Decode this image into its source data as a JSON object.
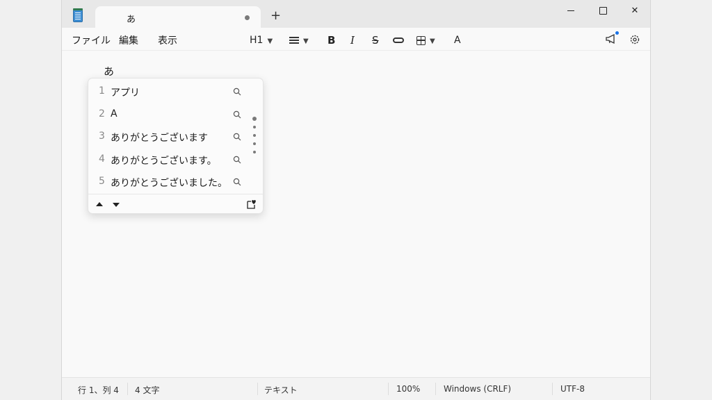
{
  "window": {
    "tab_title": "あ",
    "new_tab": "+",
    "close_glyph": "✕"
  },
  "menu": {
    "file": "ファイル",
    "edit": "編集",
    "view": "表示"
  },
  "toolbar": {
    "heading": "H1",
    "bold": "B",
    "italic": "I",
    "strikethrough": "S",
    "spellcheck": "A"
  },
  "editor": {
    "text": "あ"
  },
  "ime": {
    "candidates": [
      {
        "num": "1",
        "text": "アプリ"
      },
      {
        "num": "2",
        "text": "A"
      },
      {
        "num": "3",
        "text": "ありがとうございます"
      },
      {
        "num": "4",
        "text": "ありがとうございます。"
      },
      {
        "num": "5",
        "text": "ありがとうございました。"
      }
    ]
  },
  "status": {
    "position": "行 1、列 4",
    "chars": "4 文字",
    "format": "テキスト",
    "zoom": "100%",
    "line_ending": "Windows (CRLF)",
    "encoding": "UTF-8"
  },
  "colors": {
    "notification_dot": "#1a73e8",
    "app_icon": "#3f8fd4"
  }
}
